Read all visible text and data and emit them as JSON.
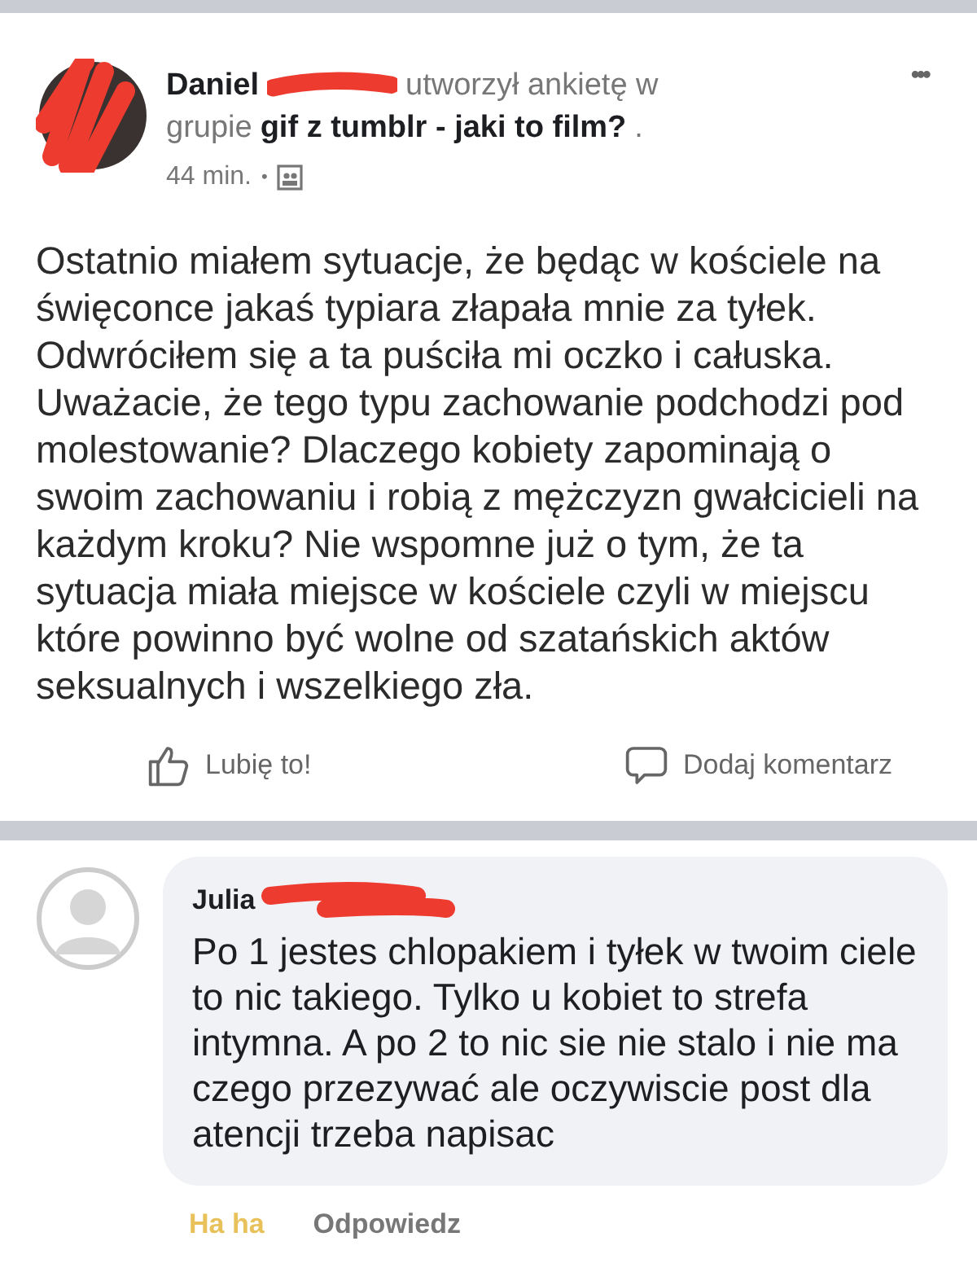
{
  "post": {
    "author": "Daniel",
    "action": "utworzył ankietę w",
    "action_2": "grupie",
    "group": "gif z tumblr - jaki to film?",
    "action_end": ".",
    "time": "44 min.",
    "separator": "•",
    "menu": "•••",
    "body": "Ostatnio miałem sytuacje, że będąc w kościele na święconce jakaś typiara złapała mnie za tyłek. Odwróciłem się a ta puściła mi oczko i całuska. Uważacie, że tego typu zachowanie podchodzi pod molestowanie? Dlaczego kobiety zapominają o swoim zachowaniu i robią z mężczyzn gwałcicieli na każdym kroku? Nie wspomne już o tym, że ta sytuacja miała miejsce w kościele czyli w miejscu które powinno być wolne od szatańskich aktów seksualnych i wszelkiego zła.",
    "actions": [
      {
        "kind": "like",
        "label": "Lubię to!"
      },
      {
        "kind": "comment",
        "label": "Dodaj komentarz"
      }
    ]
  },
  "comment": {
    "author": "Julia",
    "text": "Po 1 jestes chlopakiem i tyłek w twoim ciele to nic takiego. Tylko u kobiet to strefa intymna. A po 2 to nic sie nie stalo i nie ma czego przezywać ale oczywiscie post dla atencji trzeba napisac",
    "actions": [
      {
        "label": "Ha ha",
        "selected": true
      },
      {
        "label": "Odpowiedz",
        "selected": false
      }
    ]
  }
}
